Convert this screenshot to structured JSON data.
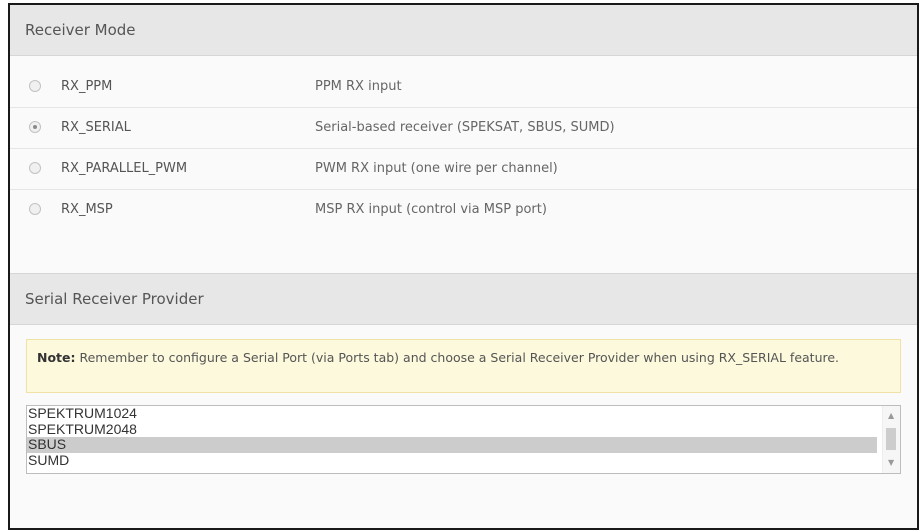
{
  "receiver_mode": {
    "title": "Receiver Mode",
    "options": [
      {
        "name": "RX_PPM",
        "desc": "PPM RX input",
        "checked": false
      },
      {
        "name": "RX_SERIAL",
        "desc": "Serial-based receiver (SPEKSAT, SBUS, SUMD)",
        "checked": true
      },
      {
        "name": "RX_PARALLEL_PWM",
        "desc": "PWM RX input (one wire per channel)",
        "checked": false
      },
      {
        "name": "RX_MSP",
        "desc": "MSP RX input (control via MSP port)",
        "checked": false
      }
    ]
  },
  "serial_provider": {
    "title": "Serial Receiver Provider",
    "note_label": "Note:",
    "note_text": " Remember to configure a Serial Port (via Ports tab) and choose a Serial Receiver Provider when using RX_SERIAL feature.",
    "providers": [
      "SPEKTRUM1024",
      "SPEKTRUM2048",
      "SBUS",
      "SUMD"
    ],
    "selected": "SBUS"
  }
}
